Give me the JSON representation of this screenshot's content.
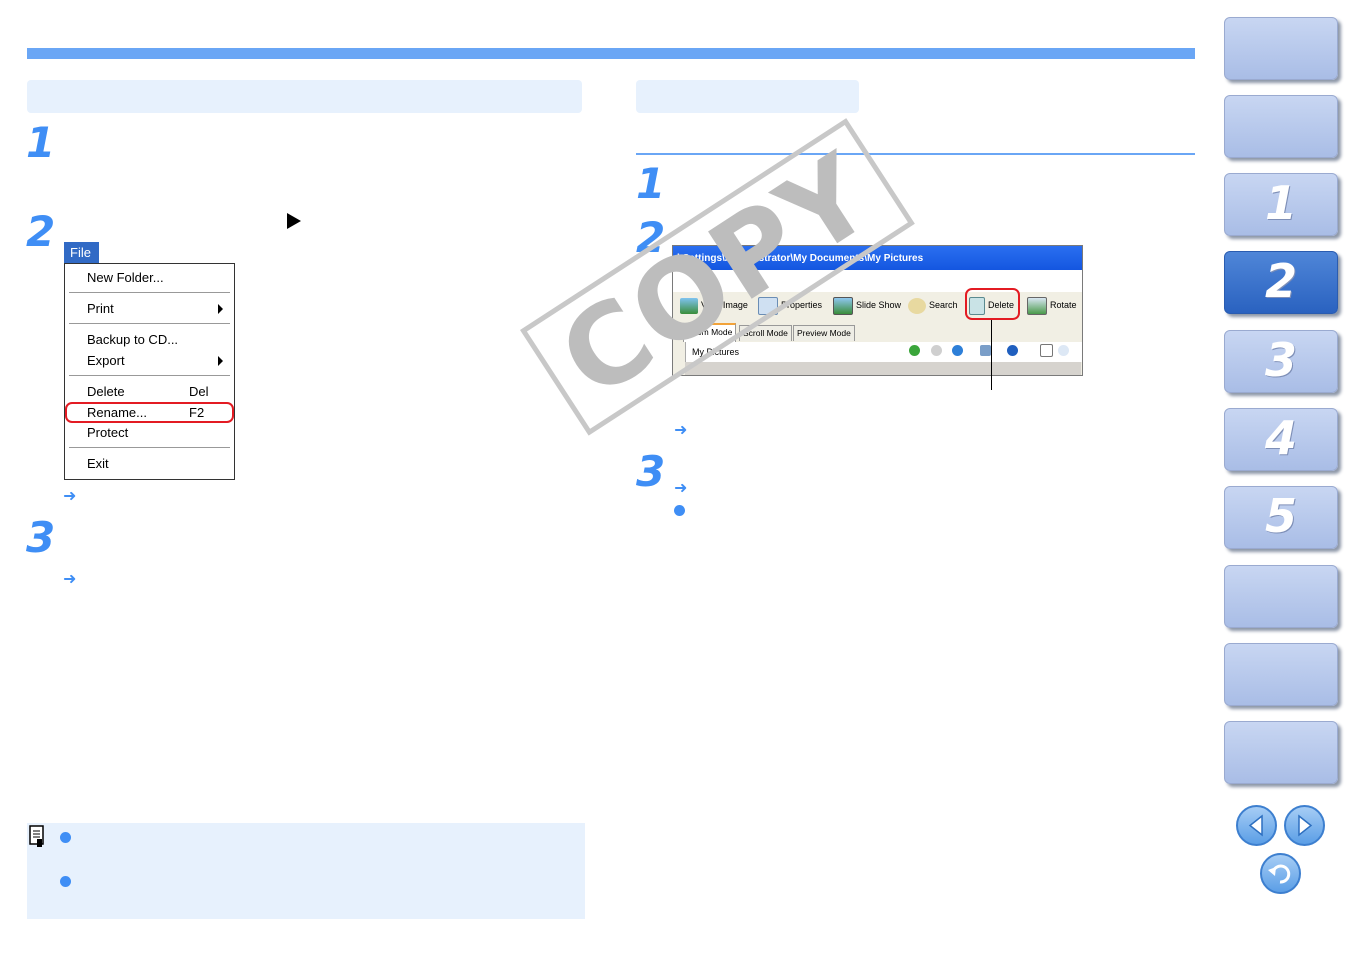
{
  "left_column": {
    "steps": [
      "1",
      "2",
      "3"
    ],
    "file_menu": {
      "tab_label": "File",
      "items": [
        {
          "label": "New Folder...",
          "shortcut": ""
        },
        {
          "label": "Print",
          "shortcut": ""
        },
        {
          "label": "Backup to CD...",
          "shortcut": ""
        },
        {
          "label": "Export",
          "shortcut": ""
        },
        {
          "label": "Delete",
          "shortcut": "Del"
        },
        {
          "label": "Rename...",
          "shortcut": "F2"
        },
        {
          "label": "Protect",
          "shortcut": ""
        },
        {
          "label": "Exit",
          "shortcut": ""
        }
      ]
    },
    "arrow_glyph": "➜"
  },
  "right_column": {
    "steps": [
      "1",
      "2",
      "3"
    ],
    "explorer": {
      "path": "l Settings\\Administrator\\My Documents\\My Pictures",
      "toolbar": [
        "View Image",
        "Properties",
        "Slide Show",
        "Search",
        "Delete",
        "Rotate"
      ],
      "tabs": [
        "Zoom Mode",
        "Scroll Mode",
        "Preview Mode"
      ],
      "folder": "My Pictures"
    },
    "arrow_glyph": "➜"
  },
  "watermark": "COPY",
  "sidebar": {
    "chapters": [
      "",
      "",
      "1",
      "2",
      "3",
      "4",
      "5",
      "",
      "",
      ""
    ],
    "active_index": 3
  },
  "colors": {
    "accent": "#3f8ef5",
    "top_bar": "#6aa6f5",
    "section_bg": "#e7f1fd",
    "highlight": "#e31b23"
  }
}
